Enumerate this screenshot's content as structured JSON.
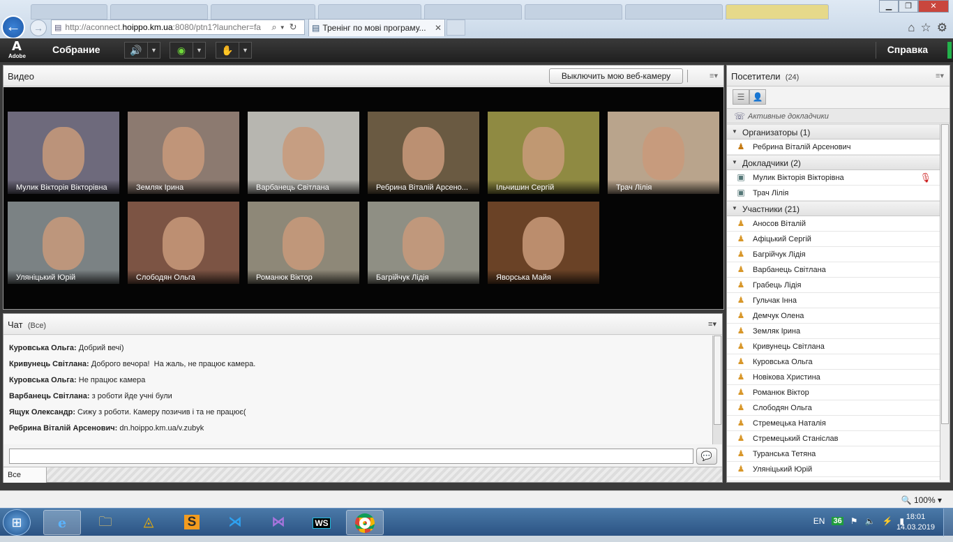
{
  "browser": {
    "url_host_prefix": "http://aconnect.",
    "url_host": "hoippo.km.ua",
    "url_rest": ":8080/ptn1?launcher=fa",
    "active_tab_title": "Тренінг по мові програму...",
    "window_controls": {
      "minimize": "▁",
      "maximize": "❐",
      "close": "✕"
    }
  },
  "appbar": {
    "meeting_menu": "Собрание",
    "help_menu": "Справка"
  },
  "video": {
    "title": "Видео",
    "webcam_button": "Выключить мою веб-камеру",
    "tiles": [
      {
        "name": "Мулик Вікторія Вікторівна",
        "bg": "#6e6a7c"
      },
      {
        "name": "Земляк Ірина",
        "bg": "#8c7a70"
      },
      {
        "name": "Варбанець Світлана",
        "bg": "#b7b6b0"
      },
      {
        "name": "Ребрина Віталій Арсено...",
        "bg": "#6a5a42"
      },
      {
        "name": "Ільчишин Сергій",
        "bg": "#8f8a42"
      },
      {
        "name": "Трач Лілія",
        "bg": "#b9a48c"
      },
      {
        "name": "Уляніцький Юрій",
        "bg": "#7b8284"
      },
      {
        "name": "Слободян Ольга",
        "bg": "#7c5444"
      },
      {
        "name": "Романюк Віктор",
        "bg": "#8e8878"
      },
      {
        "name": "Багрійчук Лідія",
        "bg": "#8f8f84"
      },
      {
        "name": "Яворська Майя",
        "bg": "#6a4226"
      }
    ]
  },
  "chat": {
    "title": "Чат",
    "scope": "(Все)",
    "messages": [
      {
        "author": "Куровська Ольга:",
        "text": " Добрий вечі)"
      },
      {
        "author": "Кривунець Світлана:",
        "text": " Доброго вечора!  На жаль, не працює камера."
      },
      {
        "author": "Куровська Ольга:",
        "text": " Не працює камера"
      },
      {
        "author": "Варбанець Світлана:",
        "text": " з роботи йде учні були"
      },
      {
        "author": "Ящук Олександр:",
        "text": " Сижу з роботи. Камеру позичив і та не працює("
      },
      {
        "author": "Ребрина Віталій Арсенович:",
        "text": " dn.hoippo.km.ua/v.zubyk"
      }
    ],
    "input_value": "",
    "tab_all": "Все"
  },
  "attendees": {
    "title": "Посетители",
    "count": "(24)",
    "active_speakers": "Активные докладчики",
    "groups": [
      {
        "label": "Организаторы (1)",
        "role": "host",
        "members": [
          "Ребрина Віталій Арсенович"
        ]
      },
      {
        "label": "Докладчики (2)",
        "role": "pres",
        "members": [
          "Мулик Вікторія Вікторівна",
          "Трач Лілія"
        ]
      },
      {
        "label": "Участники (21)",
        "role": "user",
        "members": [
          "Аносов Віталій",
          "Афіцький Сергій",
          "Багрійчук Лідія",
          "Варбанець Світлана",
          "Грабець Лідія",
          "Гульчак Інна",
          "Демчук Олена",
          "Земляк Ірина",
          "Кривунець Світлана",
          "Куровська Ольга",
          "Новікова Христина",
          "Романюк Віктор",
          "Слободян Ольга",
          "Стремецька Наталія",
          "Стремецький Станіслав",
          "Туранська Тетяна",
          "Уляніцький Юрій"
        ]
      }
    ]
  },
  "statusbar": {
    "zoom": "100%"
  },
  "taskbar": {
    "lang": "EN",
    "badge": "36",
    "time": "18:01",
    "date": "14.03.2019"
  }
}
